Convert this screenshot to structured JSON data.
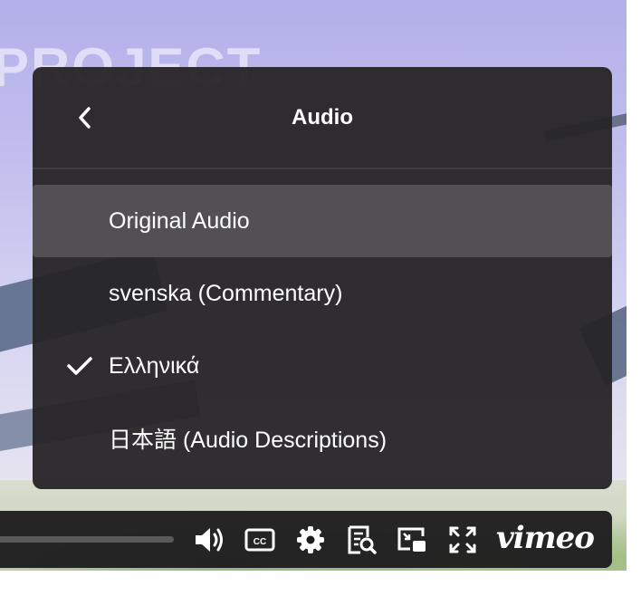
{
  "background": {
    "overlay_text": "PROJECT"
  },
  "menu": {
    "title": "Audio",
    "back_icon": "chevron-left-icon",
    "items": [
      {
        "label": "Original Audio",
        "selected": false,
        "highlighted": true
      },
      {
        "label": "svenska (Commentary)",
        "selected": false,
        "highlighted": false
      },
      {
        "label": "Ελληνικά",
        "selected": true,
        "highlighted": false
      },
      {
        "label": "日本語 (Audio Descriptions)",
        "selected": false,
        "highlighted": false
      }
    ]
  },
  "controls": {
    "icons": [
      "volume-icon",
      "closed-captions-icon",
      "settings-gear-icon",
      "transcript-icon",
      "picture-in-picture-icon",
      "fullscreen-icon"
    ],
    "logo": "vimeo"
  },
  "colors": {
    "menu_bg": "#262426",
    "menu_highlight": "#525054",
    "text": "#ffffff",
    "controls_bg": "#1c1b1d"
  }
}
